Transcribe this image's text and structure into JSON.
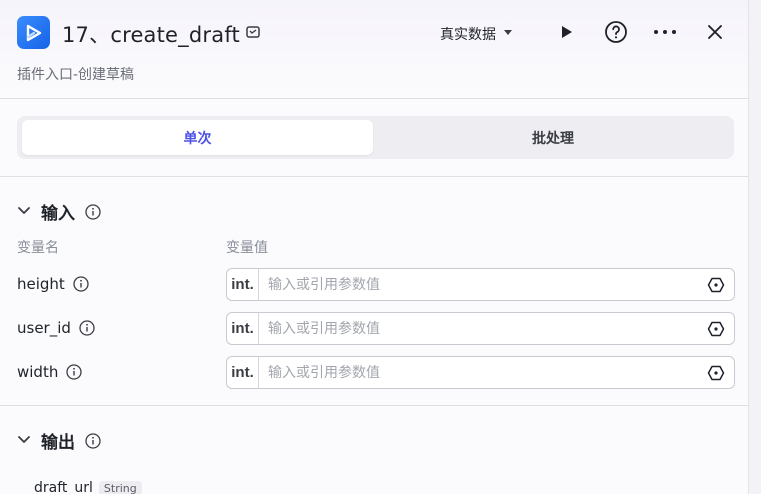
{
  "header": {
    "title": "17、create_draft",
    "subtitle": "插件入口-创建草稿",
    "env_select": "真实数据"
  },
  "tabs": [
    {
      "label": "单次",
      "active": true
    },
    {
      "label": "批处理",
      "active": false
    }
  ],
  "input_section": {
    "title": "输入",
    "col_name": "变量名",
    "col_value": "变量值",
    "rows": [
      {
        "name": "height",
        "type": "int.",
        "placeholder": "输入或引用参数值",
        "value": ""
      },
      {
        "name": "user_id",
        "type": "int.",
        "placeholder": "输入或引用参数值",
        "value": ""
      },
      {
        "name": "width",
        "type": "int.",
        "placeholder": "输入或引用参数值",
        "value": ""
      }
    ]
  },
  "output_section": {
    "title": "输出",
    "rows": [
      {
        "name": "draft_url",
        "type": "String"
      }
    ]
  },
  "colors": {
    "accent": "#4d53e8",
    "app_icon": "#1f6fef"
  }
}
